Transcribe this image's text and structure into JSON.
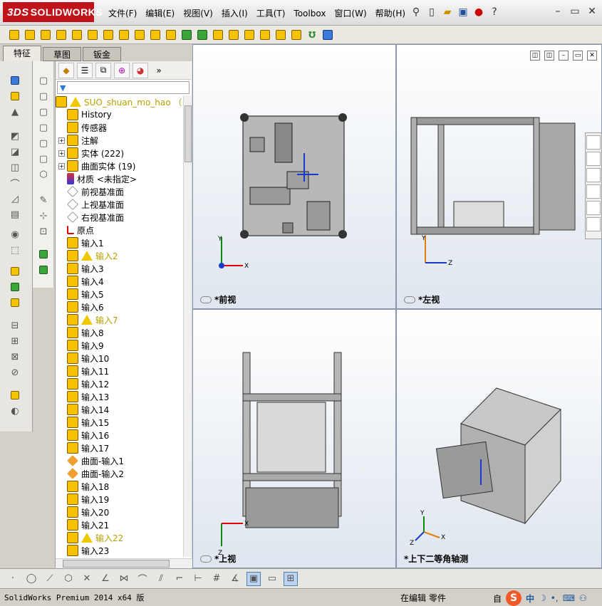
{
  "app": {
    "brand": "SOLIDWORKS",
    "brand_prefix": "3DS",
    "status": "SolidWorks Premium 2014 x64 版",
    "mode": "在编辑 零件",
    "mode_extra": "自",
    "ime_label": "中"
  },
  "menu": [
    "文件(F)",
    "编辑(E)",
    "视图(V)",
    "插入(I)",
    "工具(T)",
    "Toolbox",
    "窗口(W)",
    "帮助(H)"
  ],
  "tabs": [
    "特征",
    "草图",
    "钣金"
  ],
  "tree": {
    "root": "SUO_shuan_mo_hao （默认",
    "items": [
      {
        "label": "History",
        "icon": "history-icon",
        "exp": false
      },
      {
        "label": "传感器",
        "icon": "sensor-icon",
        "exp": false
      },
      {
        "label": "注解",
        "icon": "annotation-icon",
        "exp": true
      },
      {
        "label": "实体 (222)",
        "icon": "solid-bodies-icon",
        "exp": true
      },
      {
        "label": "曲面实体 (19)",
        "icon": "surface-bodies-icon",
        "exp": true
      },
      {
        "label": "材质 <未指定>",
        "icon": "material-icon",
        "exp": false
      },
      {
        "label": "前视基准面",
        "icon": "plane-icon",
        "exp": false
      },
      {
        "label": "上视基准面",
        "icon": "plane-icon",
        "exp": false
      },
      {
        "label": "右视基准面",
        "icon": "plane-icon",
        "exp": false
      },
      {
        "label": "原点",
        "icon": "origin-icon",
        "exp": false
      },
      {
        "label": "输入1",
        "icon": "import-icon",
        "warn": false
      },
      {
        "label": "输入2",
        "icon": "import-icon",
        "warn": true
      },
      {
        "label": "输入3",
        "icon": "import-icon",
        "warn": false
      },
      {
        "label": "输入4",
        "icon": "import-icon",
        "warn": false
      },
      {
        "label": "输入5",
        "icon": "import-icon",
        "warn": false
      },
      {
        "label": "输入6",
        "icon": "import-icon",
        "warn": false
      },
      {
        "label": "输入7",
        "icon": "import-icon",
        "warn": true
      },
      {
        "label": "输入8",
        "icon": "import-icon",
        "warn": false
      },
      {
        "label": "输入9",
        "icon": "import-icon",
        "warn": false
      },
      {
        "label": "输入10",
        "icon": "import-icon",
        "warn": false
      },
      {
        "label": "输入11",
        "icon": "import-icon",
        "warn": false
      },
      {
        "label": "输入12",
        "icon": "import-icon",
        "warn": false
      },
      {
        "label": "输入13",
        "icon": "import-icon",
        "warn": false
      },
      {
        "label": "输入14",
        "icon": "import-icon",
        "warn": false
      },
      {
        "label": "输入15",
        "icon": "import-icon",
        "warn": false
      },
      {
        "label": "输入16",
        "icon": "import-icon",
        "warn": false
      },
      {
        "label": "输入17",
        "icon": "import-icon",
        "warn": false
      },
      {
        "label": "曲面-输入1",
        "icon": "surface-import-icon",
        "warn": false
      },
      {
        "label": "曲面-输入2",
        "icon": "surface-import-icon",
        "warn": false
      },
      {
        "label": "输入18",
        "icon": "import-icon",
        "warn": false
      },
      {
        "label": "输入19",
        "icon": "import-icon",
        "warn": false
      },
      {
        "label": "输入20",
        "icon": "import-icon",
        "warn": false
      },
      {
        "label": "输入21",
        "icon": "import-icon",
        "warn": false
      },
      {
        "label": "输入22",
        "icon": "import-icon",
        "warn": true
      },
      {
        "label": "输入23",
        "icon": "import-icon",
        "warn": false
      }
    ]
  },
  "views": {
    "front": "*前视",
    "left": "*左视",
    "top": "*上视",
    "iso": "*上下二等角轴测"
  },
  "axes": {
    "x": "X",
    "y": "Y",
    "z": "Z"
  }
}
